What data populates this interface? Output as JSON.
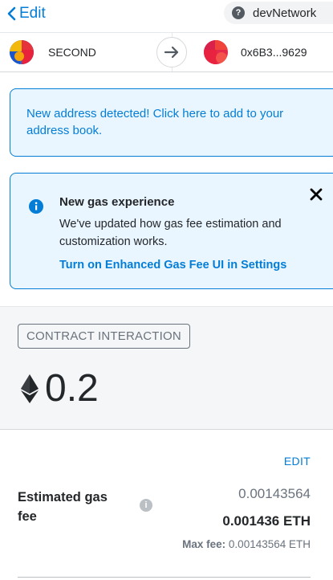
{
  "header": {
    "back_label": "Edit",
    "network": {
      "help_glyph": "?",
      "name": "devNetwork"
    }
  },
  "transfer": {
    "from": {
      "name": "SECOND",
      "icon": "identicon"
    },
    "arrow_icon": "arrow-right-icon",
    "to": {
      "address": "0x6B3...9629",
      "icon": "identicon"
    }
  },
  "address_notice": {
    "text": "New address detected! Click here to add to your address book."
  },
  "gas_notice": {
    "title": "New gas experience",
    "body": "We've updated how gas fee estimation and customization works.",
    "link": "Turn on Enhanced Gas Fee UI in Settings",
    "info_icon": "info-circle-icon",
    "close_icon": "close-icon"
  },
  "summary": {
    "badge": "CONTRACT INTERACTION",
    "amount": "0.2",
    "currency_icon": "ethereum-icon"
  },
  "gas_fee": {
    "edit_label": "EDIT",
    "label": "Estimated gas fee",
    "info_glyph": "i",
    "secondary": "0.00143564",
    "primary": "0.001436 ETH",
    "max_fee_label": "Max fee:",
    "max_fee_value": "0.00143564 ETH"
  },
  "colors": {
    "accent": "#037dd6",
    "notice_bg": "#eaf6ff",
    "text": "#24272a",
    "muted": "#6a737d"
  }
}
